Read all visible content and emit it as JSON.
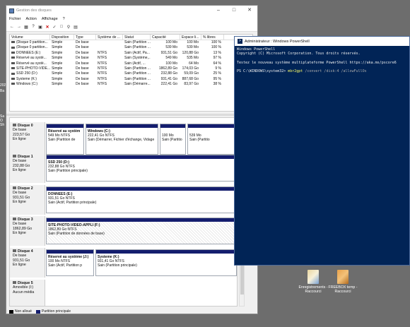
{
  "desktop": {
    "left_texts": [
      "202",
      "Ba",
      "Sa",
      "O",
      "Sh"
    ],
    "shortcuts": [
      {
        "label": "Enregistrements - Raccourci",
        "icon": "folder-shortcut-icon"
      },
      {
        "label": "FREEBOX temp - Raccourci",
        "icon": "folder-shortcut-icon"
      }
    ]
  },
  "disk_manager": {
    "title": "Gestion des disques",
    "menu": [
      "Fichier",
      "Action",
      "Affichage",
      "?"
    ],
    "columns": [
      "Volume",
      "Disposition",
      "Type",
      "Système de ...",
      "Statut",
      "Capacité",
      "Espace li...",
      "% libres"
    ],
    "volumes": [
      [
        "(Disque 0 partition...",
        "Simple",
        "De base",
        "",
        "Sain (Partition ...",
        "100 Mo",
        "100 Mo",
        "100 %"
      ],
      [
        "(Disque 0 partition...",
        "Simple",
        "De base",
        "",
        "Sain (Partition ...",
        "539 Mo",
        "539 Mo",
        "100 %"
      ],
      [
        "DONNEES (E:)",
        "Simple",
        "De base",
        "NTFS",
        "Sain (Actif, Pa...",
        "931,51 Go",
        "120,88 Go",
        "13 %"
      ],
      [
        "Réservé au systè...",
        "Simple",
        "De base",
        "NTFS",
        "Sain (Système,...",
        "549 Mo",
        "535 Mo",
        "97 %"
      ],
      [
        "Réservé au systè...",
        "Simple",
        "De base",
        "NTFS",
        "Sain (Actif, ...",
        "100 Mo",
        "64 Mo",
        "64 %"
      ],
      [
        "SITE-PHOTO-VIDE...",
        "Simple",
        "De base",
        "NTFS",
        "Sain (Partition ...",
        "1862,89 Go",
        "174,03 Go",
        "9 %"
      ],
      [
        "SSD 250 (D:)",
        "Simple",
        "De base",
        "NTFS",
        "Sain (Partition ...",
        "232,88 Go",
        "59,09 Go",
        "25 %"
      ],
      [
        "Systeme (K:)",
        "Simple",
        "De base",
        "NTFS",
        "Sain (Partition ...",
        "931,41 Go",
        "887,68 Go",
        "95 %"
      ],
      [
        "Windows (C:)",
        "Simple",
        "De base",
        "NTFS",
        "Sain (Démarre...",
        "222,41 Go",
        "83,97 Go",
        "38 %"
      ]
    ],
    "disks": [
      {
        "name": "Disque 0",
        "type": "De base",
        "size": "223,57 Go",
        "status": "En ligne",
        "parts": [
          {
            "title": "Réservé au systèm",
            "l1": "549 Mo NTFS",
            "l2": "Sain (Partition de"
          },
          {
            "title": "Windows (C:)",
            "l1": "222,41 Go NTFS",
            "l2": "Sain (Démarrer, Fichier d'échange, Vidage"
          },
          {
            "title": "",
            "l1": "100 Mo",
            "l2": "Sain (Partitio"
          },
          {
            "title": "",
            "l1": "539 Mo",
            "l2": "Sain (Partitio"
          }
        ]
      },
      {
        "name": "Disque 1",
        "type": "De base",
        "size": "232,88 Go",
        "status": "En ligne",
        "parts": [
          {
            "title": "SSD 250  (D:)",
            "l1": "232,88 Go NTFS",
            "l2": "Sain (Partition principale)"
          }
        ]
      },
      {
        "name": "Disque 2",
        "type": "De base",
        "size": "931,51 Go",
        "status": "En ligne",
        "parts": [
          {
            "title": "DONNEES  (E:)",
            "l1": "931,51 Go NTFS",
            "l2": "Sain (Actif, Partition principale)"
          }
        ]
      },
      {
        "name": "Disque 3",
        "type": "De base",
        "size": "1862,89 Go",
        "status": "En ligne",
        "parts": [
          {
            "title": "SITE-PHOTO-VIDEO-APPLI  (F:)",
            "l1": "1862,89 Go NTFS",
            "l2": "Sain (Partition de données de base)"
          }
        ]
      },
      {
        "name": "Disque 4",
        "type": "De base",
        "size": "931,51 Go",
        "status": "En ligne",
        "parts": [
          {
            "title": "Réservé au système  (J:)",
            "l1": "100 Mo NTFS",
            "l2": "Sain (Actif, Partition p"
          },
          {
            "title": "Systeme  (K:)",
            "l1": "931,41 Go NTFS",
            "l2": "Sain (Partition principale)"
          }
        ]
      },
      {
        "name": "Disque 5",
        "type": "Amovible (I:)",
        "size": "",
        "status": "Aucun média",
        "parts": []
      }
    ],
    "legend": [
      {
        "label": "Non alloué",
        "color": "#000000"
      },
      {
        "label": "Partition principale",
        "color": "#141d6e"
      }
    ]
  },
  "powershell": {
    "title": "Administrateur : Windows PowerShell",
    "lines": [
      "Windows PowerShell",
      "Copyright (C) Microsoft Corporation. Tous droits réservés.",
      "",
      "Testez le nouveau système multiplateforme PowerShell https://aka.ms/pscore6",
      ""
    ],
    "prompt": "PS C:\\WINDOWS\\system32> ",
    "command": "mbr2gpt",
    "args": " /convert /disk:4 /allowFullOs"
  }
}
